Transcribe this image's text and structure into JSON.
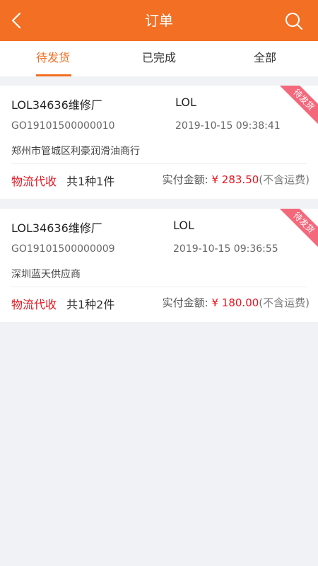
{
  "header": {
    "title": "订单"
  },
  "tabs": [
    {
      "label": "待发货",
      "active": true
    },
    {
      "label": "已完成",
      "active": false
    },
    {
      "label": "全部",
      "active": false
    }
  ],
  "orders": [
    {
      "name": "LOL34636维修厂",
      "code": "LOL",
      "order_no": "GO19101500000010",
      "time": "2019-10-15 09:38:41",
      "address": "郑州市管城区利豪润滑油商行",
      "pay_method": "物流代收",
      "quantity": "共1种1件",
      "amount_label": "实付金额: ",
      "amount": "¥ 283.50",
      "amount_note": "(不含运费)",
      "status": "待发货"
    },
    {
      "name": "LOL34636维修厂",
      "code": "LOL",
      "order_no": "GO19101500000009",
      "time": "2019-10-15 09:36:55",
      "address": "深圳蓝天供应商",
      "pay_method": "物流代收",
      "quantity": "共1种2件",
      "amount_label": "实付金额: ",
      "amount": "¥ 180.00",
      "amount_note": "(不含运费)",
      "status": "待发货"
    }
  ],
  "colors": {
    "accent": "#f36f23",
    "price": "#e4141e",
    "ribbon": "#f4687c"
  },
  "icons": {
    "back": "chevron-left-icon",
    "search": "search-icon"
  }
}
